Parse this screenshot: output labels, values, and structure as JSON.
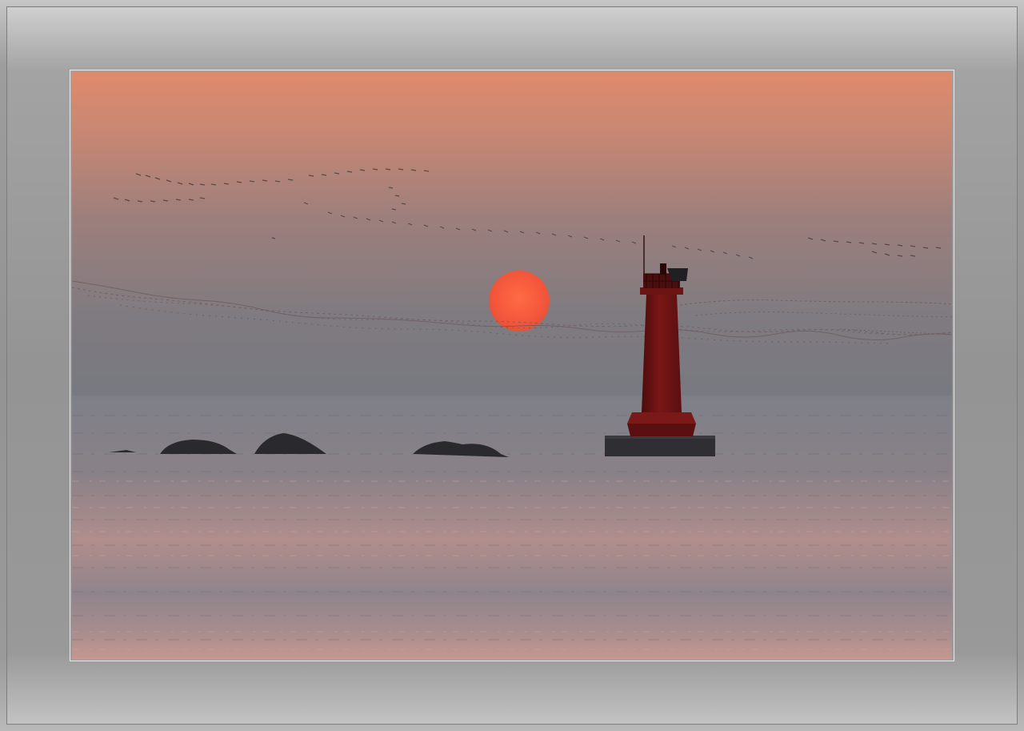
{
  "image": {
    "subject": "",
    "colors": {
      "sky_top": "#e08c6f",
      "sky_mid": "#9a7f7a",
      "sky_horizon": "#77797f",
      "sun": "#ff5a3a",
      "sea": "#7b7c84",
      "sea_reflection": "#c8988c",
      "lighthouse": "#6e1414",
      "rocks": "#2b2b2e",
      "frame": "#959595"
    }
  }
}
